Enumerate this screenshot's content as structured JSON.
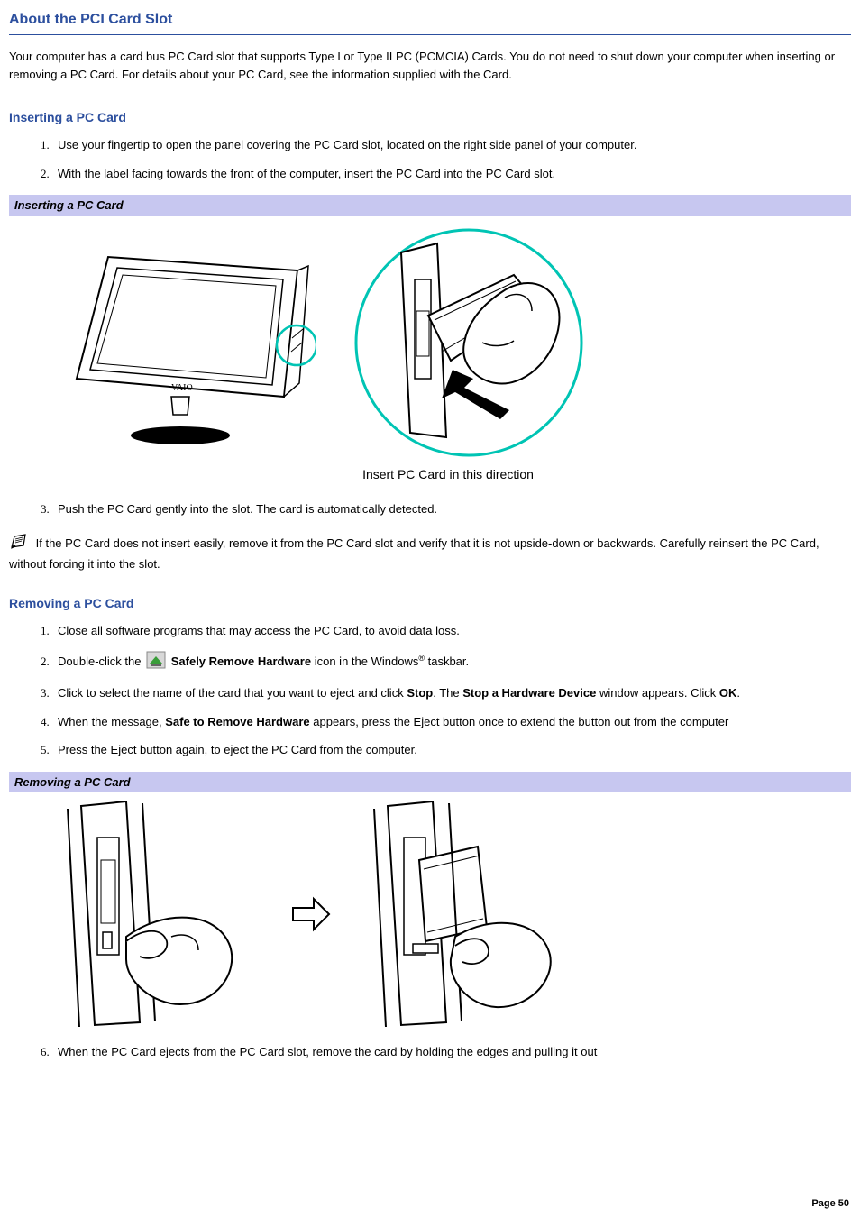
{
  "heading_main": "About the PCI Card Slot",
  "intro": "Your computer has a card bus PC Card slot that supports Type I or Type II PC (PCMCIA) Cards. You do not need to shut down your computer when inserting or removing a PC Card. For details about your PC Card, see the information supplied with the Card.",
  "section_insert": {
    "heading": "Inserting a PC Card",
    "steps_a": [
      "Use your fingertip to open the panel covering the PC Card slot, located on the right side panel of your computer.",
      "With the label facing towards the front of the computer, insert the PC Card into the PC Card slot."
    ],
    "caption": "Inserting a PC Card",
    "figure_caption": "Insert PC Card in this direction",
    "steps_b_start": 3,
    "steps_b": [
      "Push the PC Card gently into the slot. The card is automatically detected."
    ],
    "note": "If the PC Card does not insert easily, remove it from the PC Card slot and verify that it is not upside-down or backwards. Carefully reinsert the PC Card, without forcing it into the slot."
  },
  "section_remove": {
    "heading": "Removing a PC Card",
    "step1": "Close all software programs that may access the PC Card, to avoid data loss.",
    "step2_pre": "Double-click the ",
    "step2_bold": "Safely Remove Hardware",
    "step2_post_a": " icon in the Windows",
    "step2_reg": "®",
    "step2_post_b": " taskbar.",
    "step3_pre": "Click to select the name of the card that you want to eject and click ",
    "step3_stop": "Stop",
    "step3_mid": ". The ",
    "step3_window": "Stop a Hardware Device",
    "step3_post": " window appears. Click ",
    "step3_ok": "OK",
    "step3_end": ".",
    "step4_pre": "When the message, ",
    "step4_bold": "Safe to Remove Hardware",
    "step4_post": " appears, press the Eject button once to extend the button out from the computer",
    "step5": "Press the Eject button again, to eject the PC Card from the computer.",
    "caption": "Removing a PC Card",
    "step6": "When the PC Card ejects from the PC Card slot, remove the card by holding the edges and pulling it out"
  },
  "page_label": "Page 50"
}
